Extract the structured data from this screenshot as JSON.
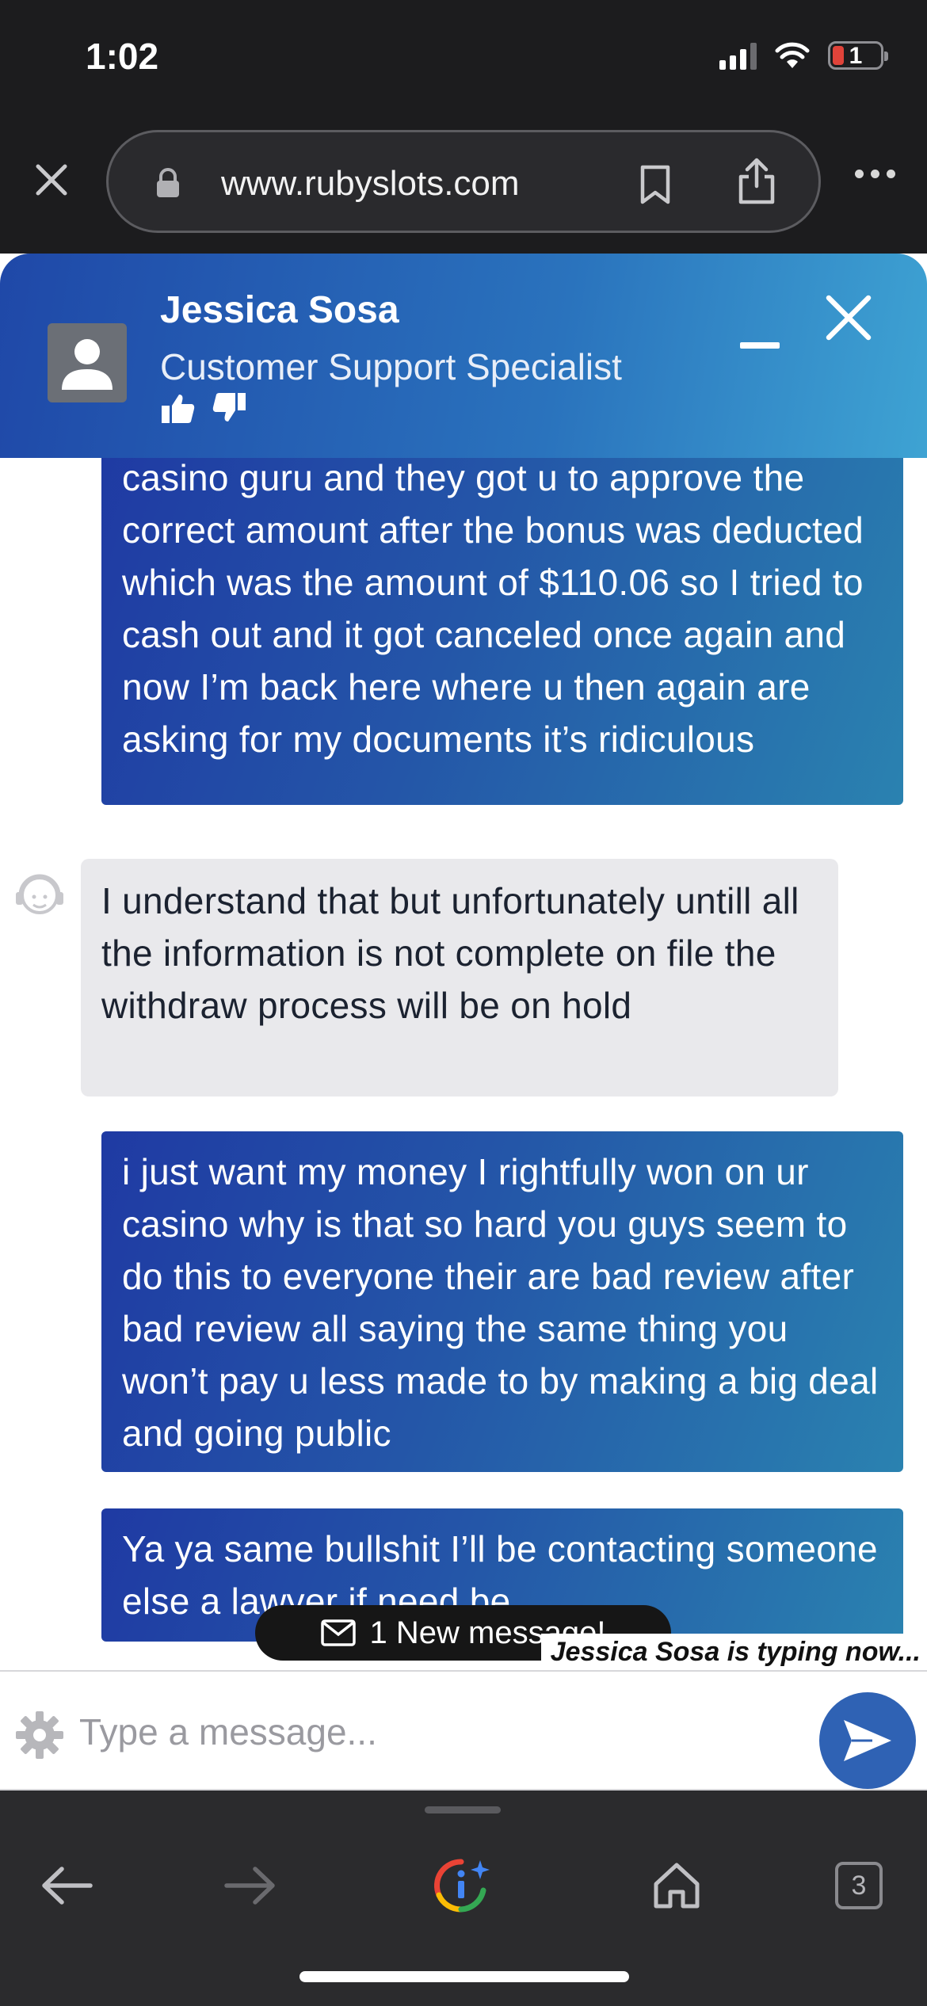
{
  "status_bar": {
    "time": "1:02",
    "battery_level": "1"
  },
  "browser": {
    "url": "www.rubyslots.com",
    "tab_count": "3"
  },
  "chat": {
    "agent_name": "Jessica Sosa",
    "agent_role": "Customer Support Specialist",
    "messages": [
      {
        "from": "user",
        "text": "casino guru and they got u to approve the correct amount after the bonus was deducted which was the amount of $110.06 so I tried to cash out and it got canceled once again and now I’m back here where u then again are asking for my documents it’s ridiculous"
      },
      {
        "from": "agent",
        "text": "I understand that but unfortunately untill all the information is not complete on file the withdraw process will be on hold"
      },
      {
        "from": "user",
        "text": "i just want my money I rightfully won on ur casino why is that so hard you guys seem to do this to everyone their are bad review after bad review all saying the same thing you won’t pay u less made to by making a big deal and going public"
      },
      {
        "from": "user",
        "text": "Ya ya same bullshit I’ll be contacting someone else a lawyer if need be"
      }
    ],
    "new_message_label": "1 New message!",
    "typing_indicator": "Jessica Sosa is typing now...",
    "input_placeholder": "Type a message..."
  },
  "colors": {
    "header_gradient_start": "#1f48a8",
    "header_gradient_end": "#3ea3d3",
    "user_bubble": "#2456a8",
    "agent_bubble": "#e9e9ec",
    "send_button": "#2f62b4"
  }
}
